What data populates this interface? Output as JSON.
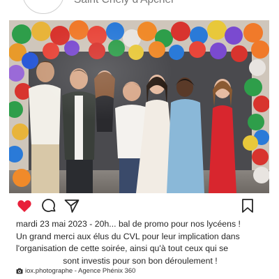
{
  "header": {
    "location": "Saint Chély d'Apcher"
  },
  "post": {
    "liked": true,
    "icons": [
      "heart-icon",
      "comment-icon",
      "share-icon",
      "bookmark-icon"
    ],
    "colors": {
      "like": "#e8203a",
      "text": "#262626",
      "muted": "#777777"
    }
  },
  "caption": {
    "lines": [
      "mardi 23 mai 2023 - 20h... bal de promo pour nos lycéens !",
      "Un grand merci aux élus du CVL pour leur implication dans",
      "l'organisation de cette soirée, ainsi qu'à tout ceux qui se",
      "sont investis pour son bon déroulement !"
    ]
  },
  "credit": {
    "icon": "camera-icon",
    "text": "iox.photographe - Agence Phénix 360"
  }
}
